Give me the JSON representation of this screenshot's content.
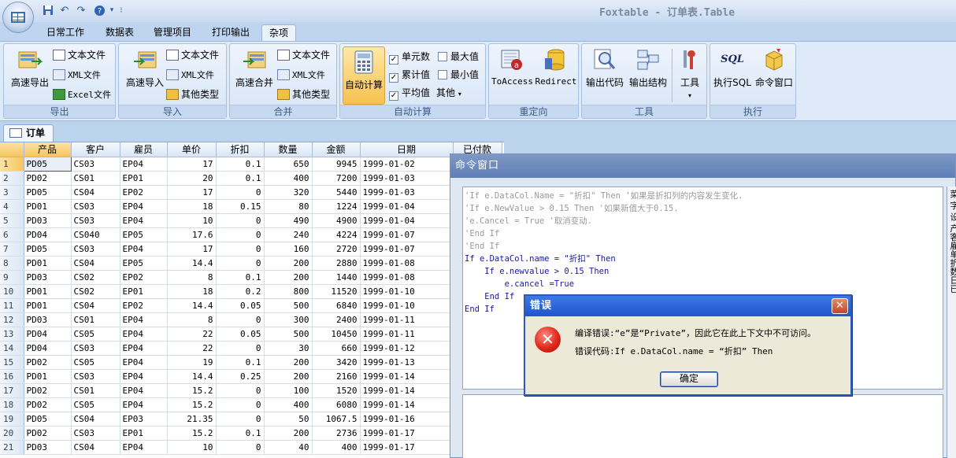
{
  "window": {
    "title": "Foxtable - 订单表.Table"
  },
  "ribbon_tabs": [
    "日常工作",
    "数据表",
    "管理项目",
    "打印输出",
    "杂项"
  ],
  "ribbon": {
    "export": {
      "big": "高速导出",
      "items": [
        "文本文件",
        "XML文件",
        "Excel文件"
      ],
      "label": "导出"
    },
    "import": {
      "big": "高速导入",
      "items": [
        "文本文件",
        "XML文件",
        "其他类型"
      ],
      "label": "导入"
    },
    "merge": {
      "big": "高速合并",
      "items": [
        "文本文件",
        "XML文件",
        "其他类型"
      ],
      "label": "合并"
    },
    "autocalc": {
      "big": "自动计算",
      "checks": [
        {
          "label": "单元数",
          "checked": true
        },
        {
          "label": "累计值",
          "checked": true
        },
        {
          "label": "平均值",
          "checked": true
        },
        {
          "label": "最大值",
          "checked": false
        },
        {
          "label": "最小值",
          "checked": false
        }
      ],
      "other": "其他",
      "label": "自动计算"
    },
    "redirect": {
      "items": [
        "ToAccess",
        "Redirect"
      ],
      "label": "重定向"
    },
    "tools": {
      "items": [
        "输出代码",
        "输出结构",
        "工具"
      ],
      "label": "工具"
    },
    "execute": {
      "items": [
        "执行SQL",
        "命令窗口"
      ],
      "sql_icon_text": "SQL",
      "label": "执行"
    }
  },
  "doc_tab": "订单",
  "grid": {
    "columns": [
      "产品",
      "客户",
      "雇员",
      "单价",
      "折扣",
      "数量",
      "金额",
      "日期"
    ],
    "extra_column": "已付款",
    "rows": [
      [
        "1",
        "PD05",
        "CS03",
        "EP04",
        "17",
        "0.1",
        "650",
        "9945",
        "1999-01-02"
      ],
      [
        "2",
        "PD02",
        "CS01",
        "EP01",
        "20",
        "0.1",
        "400",
        "7200",
        "1999-01-03"
      ],
      [
        "3",
        "PD05",
        "CS04",
        "EP02",
        "17",
        "0",
        "320",
        "5440",
        "1999-01-03"
      ],
      [
        "4",
        "PD01",
        "CS03",
        "EP04",
        "18",
        "0.15",
        "80",
        "1224",
        "1999-01-04"
      ],
      [
        "5",
        "PD03",
        "CS03",
        "EP04",
        "10",
        "0",
        "490",
        "4900",
        "1999-01-04"
      ],
      [
        "6",
        "PD04",
        "CS040",
        "EP05",
        "17.6",
        "0",
        "240",
        "4224",
        "1999-01-07"
      ],
      [
        "7",
        "PD05",
        "CS03",
        "EP04",
        "17",
        "0",
        "160",
        "2720",
        "1999-01-07"
      ],
      [
        "8",
        "PD01",
        "CS04",
        "EP05",
        "14.4",
        "0",
        "200",
        "2880",
        "1999-01-08"
      ],
      [
        "9",
        "PD03",
        "CS02",
        "EP02",
        "8",
        "0.1",
        "200",
        "1440",
        "1999-01-08"
      ],
      [
        "10",
        "PD01",
        "CS02",
        "EP01",
        "18",
        "0.2",
        "800",
        "11520",
        "1999-01-10"
      ],
      [
        "11",
        "PD01",
        "CS04",
        "EP02",
        "14.4",
        "0.05",
        "500",
        "6840",
        "1999-01-10"
      ],
      [
        "12",
        "PD03",
        "CS01",
        "EP04",
        "8",
        "0",
        "300",
        "2400",
        "1999-01-11"
      ],
      [
        "13",
        "PD04",
        "CS05",
        "EP04",
        "22",
        "0.05",
        "500",
        "10450",
        "1999-01-11"
      ],
      [
        "14",
        "PD04",
        "CS03",
        "EP04",
        "22",
        "0",
        "30",
        "660",
        "1999-01-12"
      ],
      [
        "15",
        "PD02",
        "CS05",
        "EP04",
        "19",
        "0.1",
        "200",
        "3420",
        "1999-01-13"
      ],
      [
        "16",
        "PD01",
        "CS03",
        "EP04",
        "14.4",
        "0.25",
        "200",
        "2160",
        "1999-01-14"
      ],
      [
        "17",
        "PD02",
        "CS01",
        "EP04",
        "15.2",
        "0",
        "100",
        "1520",
        "1999-01-14"
      ],
      [
        "18",
        "PD02",
        "CS05",
        "EP04",
        "15.2",
        "0",
        "400",
        "6080",
        "1999-01-14"
      ],
      [
        "19",
        "PD05",
        "CS04",
        "EP03",
        "21.35",
        "0",
        "50",
        "1067.5",
        "1999-01-16"
      ],
      [
        "20",
        "PD02",
        "CS03",
        "EP01",
        "15.2",
        "0.1",
        "200",
        "2736",
        "1999-01-17"
      ],
      [
        "21",
        "PD03",
        "CS04",
        "EP04",
        "10",
        "0",
        "40",
        "400",
        "1999-01-17"
      ]
    ]
  },
  "command_window": {
    "title": "命令窗口",
    "code_lines": [
      "'If e.DataCol.Name = \"折扣\" Then '如果是折扣列的内容发生变化.",
      "'If e.NewValue > 0.15 Then '如果新值大于0.15.",
      "'e.Cancel = True '取消变动.",
      "'End If",
      "'End If",
      "If e.DataCol.name = \"折扣\" Then",
      "    If e.newvalue > 0.15 Then",
      "        e.cancel =True",
      "    End If",
      "End If"
    ],
    "side_text": "菜 字 设 产客雇单折数日已"
  },
  "error_dialog": {
    "title": "错误",
    "line1": "编译错误:“e”是“Private”，因此它在此上下文中不可访问。",
    "line2": "错误代码:If e.DataCol.name = “折扣” Then",
    "ok": "确定",
    "close": "✕"
  }
}
